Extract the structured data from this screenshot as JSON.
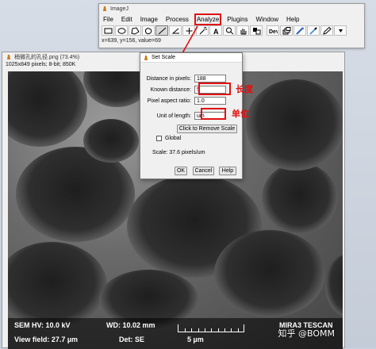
{
  "imagej": {
    "title": "ImageJ",
    "menu": [
      "File",
      "Edit",
      "Image",
      "Process",
      "Analyze",
      "Plugins",
      "Window",
      "Help"
    ],
    "status": "x=639, y=156, value=69",
    "tools": [
      "rectangle-tool",
      "oval-tool",
      "polygon-tool",
      "freehand-tool",
      "straight-line-tool",
      "angle-tool",
      "point-tool",
      "wand-tool",
      "text-tool",
      "magnifier-tool",
      "scrolling-tool",
      "color-picker-tool",
      "developer-menu",
      "stacks-menu",
      "lut-menu",
      "dropper-tool",
      "pencil-tool"
    ]
  },
  "image_window": {
    "title": "稍微孔的孔径.png (73.4%)",
    "info": "1025x849 pixels; 8-bit; 850K",
    "sem": {
      "hv": "SEM HV: 10.0 kV",
      "wd": "WD: 10.02 mm",
      "brand": "MIRA3 TESCAN",
      "view_field": "View field: 27.7 µm",
      "det": "Det: SE",
      "scale": "5 µm"
    }
  },
  "dialog": {
    "title": "Set Scale",
    "distance_label": "Distance in pixels:",
    "distance_value": "188",
    "known_label": "Known distance:",
    "known_value": "5",
    "aspect_label": "Pixel aspect ratio:",
    "aspect_value": "1.0",
    "unit_label": "Unit of length:",
    "unit_value": "um",
    "remove_button": "Click to Remove Scale",
    "global_label": "Global",
    "scale_text": "Scale: 37.6 pixels/um",
    "ok": "OK",
    "cancel": "Cancel",
    "help": "Help"
  },
  "annotations": {
    "length": "长度",
    "unit": "单位"
  },
  "watermark": "知乎 @BOMM",
  "colors": {
    "highlight": "#e01010"
  }
}
